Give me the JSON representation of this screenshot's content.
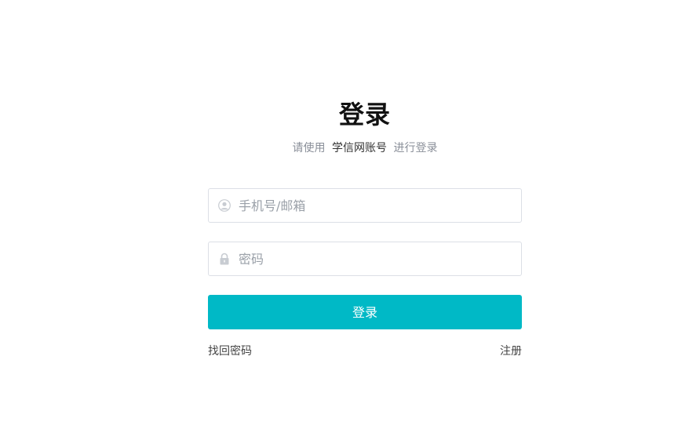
{
  "login": {
    "title": "登录",
    "subtitle_prefix": "请使用",
    "subtitle_account": "学信网账号",
    "subtitle_suffix": "进行登录",
    "username": {
      "placeholder": "手机号/邮箱",
      "value": "",
      "icon": "user-icon"
    },
    "password": {
      "placeholder": "密码",
      "value": "",
      "icon": "lock-icon"
    },
    "submit_label": "登录",
    "forgot_label": "找回密码",
    "register_label": "注册"
  },
  "colors": {
    "accent": "#00b9c6",
    "title": "#111111",
    "muted": "#8a8f99",
    "border": "#dcdfe6"
  }
}
